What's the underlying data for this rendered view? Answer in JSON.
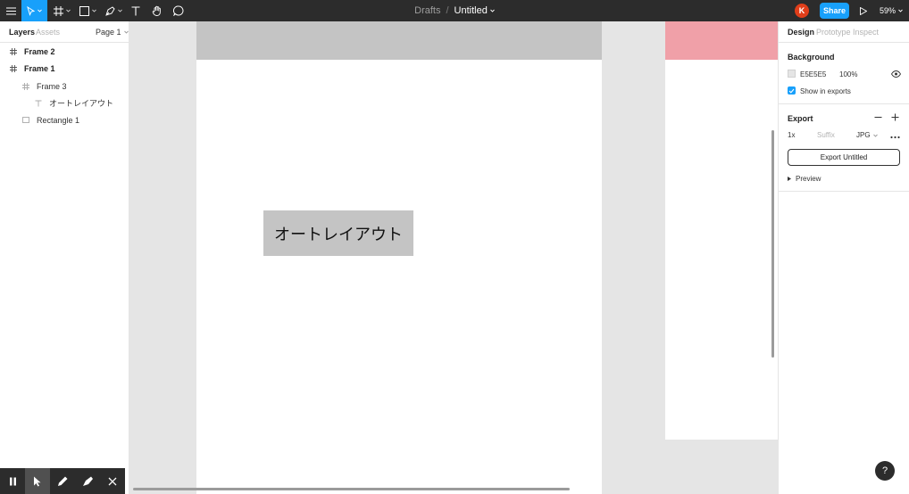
{
  "toolbar": {
    "breadcrumb_drafts": "Drafts",
    "breadcrumb_sep": "/",
    "file_name": "Untitled",
    "avatar_initial": "K",
    "share_label": "Share",
    "zoom": "59%",
    "icons": [
      "menu-icon",
      "move-tool-icon",
      "frame-tool-icon",
      "shape-tool-icon",
      "pen-tool-icon",
      "text-tool-icon",
      "hand-tool-icon",
      "comment-tool-icon",
      "play-icon"
    ]
  },
  "left_panel": {
    "tabs": {
      "layers": "Layers",
      "assets": "Assets"
    },
    "page": "Page 1",
    "layers": [
      {
        "name": "Frame 2",
        "type": "frame"
      },
      {
        "name": "Frame 1",
        "type": "frame"
      },
      {
        "name": "Frame 3",
        "type": "frame"
      },
      {
        "name": "オートレイアウト",
        "type": "text"
      },
      {
        "name": "Rectangle 1",
        "type": "rectangle"
      }
    ]
  },
  "canvas": {
    "autolayout_text": "オートレイアウト",
    "colors": {
      "gray_fill": "#c4c4c4",
      "pink_fill": "#f0a0a8",
      "canvas_bg": "#e5e5e5"
    }
  },
  "right_panel": {
    "tabs": {
      "design": "Design",
      "prototype": "Prototype",
      "inspect": "Inspect"
    },
    "background": {
      "title": "Background",
      "hex": "E5E5E5",
      "opacity": "100%",
      "show_in_exports": "Show in exports"
    },
    "export": {
      "title": "Export",
      "scale": "1x",
      "suffix_placeholder": "Suffix",
      "format": "JPG",
      "export_button": "Export Untitled",
      "preview": "Preview"
    }
  },
  "help": "?",
  "accent_color": "#18a0fb"
}
